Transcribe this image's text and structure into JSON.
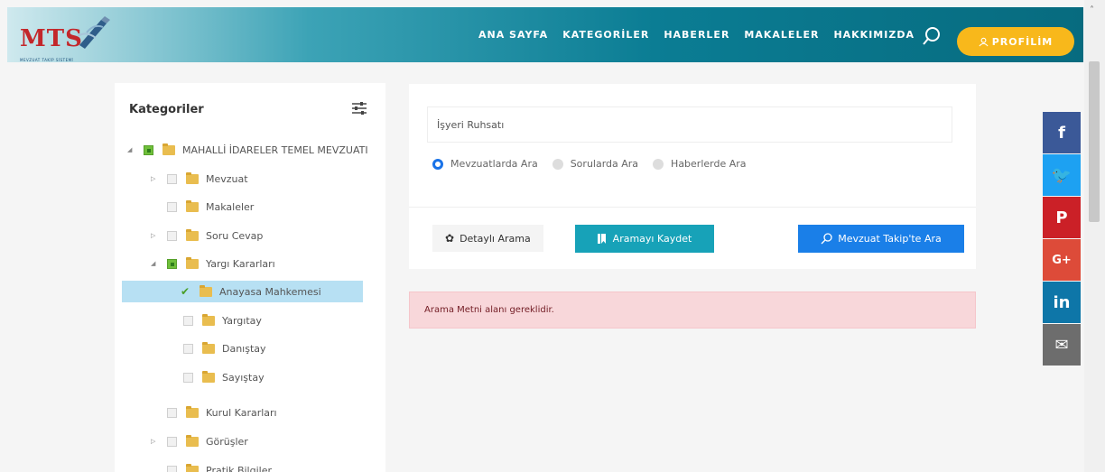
{
  "header": {
    "logo_text": "MTS",
    "logo_sub": "MEVZUAT TAKİP SİSTEMİ",
    "nav": [
      "ANA SAYFA",
      "KATEGORİLER",
      "HABERLER",
      "MAKALELER",
      "HAKKIMIZDA"
    ],
    "search_icon": "search-icon",
    "profile_label": "PROFİLİM",
    "colors": {
      "accent": "#0b7d94",
      "profile": "#f8b81b",
      "logo": "#c3272b"
    }
  },
  "sidebar": {
    "title": "Kategoriler",
    "filter_icon": "sliders-icon",
    "items": [
      {
        "label": "MAHALLİ İDARELER TEMEL MEVZUATI",
        "level": 0,
        "expander": "expanded",
        "checked": "partial",
        "selected": false
      },
      {
        "label": "Mevzuat",
        "level": 1,
        "expander": "collapsed",
        "checked": "none",
        "selected": false
      },
      {
        "label": "Makaleler",
        "level": 1,
        "expander": "none",
        "checked": "none",
        "selected": false
      },
      {
        "label": "Soru Cevap",
        "level": 1,
        "expander": "collapsed",
        "checked": "none",
        "selected": false
      },
      {
        "label": "Yargı Kararları",
        "level": 1,
        "expander": "expanded",
        "checked": "partial",
        "selected": false
      },
      {
        "label": "Anayasa Mahkemesi",
        "level": 2,
        "expander": "none",
        "checked": "checked",
        "selected": true
      },
      {
        "label": "Yargıtay",
        "level": 2,
        "expander": "none",
        "checked": "none",
        "selected": false
      },
      {
        "label": "Danıştay",
        "level": 2,
        "expander": "none",
        "checked": "none",
        "selected": false
      },
      {
        "label": "Sayıştay",
        "level": 2,
        "expander": "none",
        "checked": "none",
        "selected": false
      },
      {
        "label": "Kurul Kararları",
        "level": 1,
        "expander": "none",
        "checked": "none",
        "selected": false
      },
      {
        "label": "Görüşler",
        "level": 1,
        "expander": "collapsed",
        "checked": "none",
        "selected": false
      },
      {
        "label": "Pratik Bilgiler",
        "level": 1,
        "expander": "none",
        "checked": "none",
        "selected": false
      }
    ]
  },
  "search": {
    "input_value": "İşyeri Ruhsatı",
    "radios": [
      {
        "label": "Mevzuatlarda Ara",
        "selected": true
      },
      {
        "label": "Sorularda Ara",
        "selected": false
      },
      {
        "label": "Haberlerde Ara",
        "selected": false
      }
    ],
    "detail_label": "Detaylı Arama",
    "save_label": "Aramayı Kaydet",
    "search_label": "Mevzuat Takip'te Ara"
  },
  "alert": {
    "text": "Arama Metni alanı gereklidir."
  },
  "social": [
    {
      "icon": "facebook-icon",
      "glyph": "f",
      "color": "#3b5998"
    },
    {
      "icon": "twitter-icon",
      "glyph": "🐦",
      "color": "#1da1f2"
    },
    {
      "icon": "pinterest-icon",
      "glyph": "P",
      "color": "#cb2027"
    },
    {
      "icon": "google-plus-icon",
      "glyph": "G+",
      "color": "#dd4b39"
    },
    {
      "icon": "linkedin-icon",
      "glyph": "in",
      "color": "#0e76a8"
    },
    {
      "icon": "email-icon",
      "glyph": "✉",
      "color": "#6d6d6d"
    }
  ]
}
